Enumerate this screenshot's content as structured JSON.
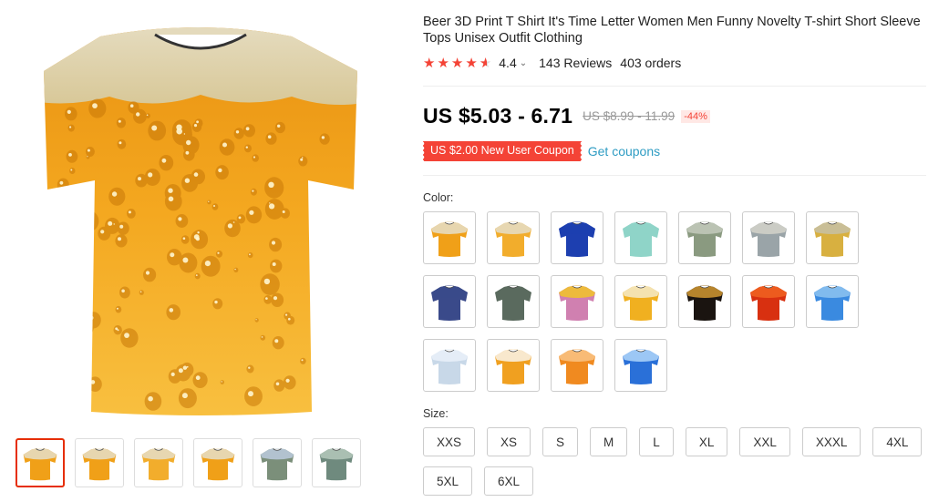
{
  "product": {
    "title": "Beer 3D Print T Shirt It's Time Letter Women Men Funny Novelty T-shirt Short Sleeve Tops Unisex Outfit Clothing",
    "rating_value": "4.4",
    "rating_stars": 4.4,
    "reviews": "143 Reviews",
    "orders": "403 orders",
    "price": "US $5.03 - 6.71",
    "original_price": "US $8.99 - 11.99",
    "discount": "-44%",
    "coupon": "US $2.00 New User Coupon",
    "get_coupons": "Get coupons",
    "color_label": "Color:",
    "size_label": "Size:",
    "sizes": [
      "XXS",
      "XS",
      "S",
      "M",
      "L",
      "XL",
      "XXL",
      "XXXL",
      "4XL",
      "5XL",
      "6XL"
    ]
  },
  "colors": {
    "accent": "#f44336",
    "link": "#2e9cc3",
    "selected_border": "#e62e04",
    "beer": "#f0a018",
    "foam": "#e6dcc0"
  },
  "thumbnails": [
    {
      "icon": "beer-shirt-icon",
      "fill": "#f0a018",
      "top": "#e6dcc0"
    },
    {
      "icon": "beer-shirt-icon",
      "fill": "#f0a018",
      "top": "#e6dcc0"
    },
    {
      "icon": "beer-print-shirt-icon",
      "fill": "#f2ad2c",
      "top": "#e6dcc0"
    },
    {
      "icon": "beer-shirt-icon",
      "fill": "#f0a018",
      "top": "#e6dcc0"
    },
    {
      "icon": "cartoon-shirt-icon",
      "fill": "#7b8f7a",
      "top": "#b8c8d8"
    },
    {
      "icon": "cartoon-shirt-icon",
      "fill": "#6f8a7e",
      "top": "#b0c4b8"
    }
  ],
  "color_swatches": [
    {
      "icon": "beer-shirt-icon",
      "fill": "#f0a018",
      "top": "#e6dcc0"
    },
    {
      "icon": "beer-print-shirt-icon",
      "fill": "#f2ad2c",
      "top": "#e6dcc0"
    },
    {
      "icon": "blue-cartoon-shirt-icon",
      "fill": "#1d3fb0",
      "top": "#1d3fb0"
    },
    {
      "icon": "mint-cartoon-shirt-icon",
      "fill": "#8fd4c8",
      "top": "#8fd4c8"
    },
    {
      "icon": "collage-shirt-icon",
      "fill": "#8a9a80",
      "top": "#c0c8b8"
    },
    {
      "icon": "collage-shirt-icon",
      "fill": "#9aa4a8",
      "top": "#d0d0c8"
    },
    {
      "icon": "cartoon-collage-shirt-icon",
      "fill": "#d8b040",
      "top": "#c8c0a0"
    },
    {
      "icon": "navy-cartoon-shirt-icon",
      "fill": "#3a4a8a",
      "top": "#3a4a8a"
    },
    {
      "icon": "gray-cartoon-shirt-icon",
      "fill": "#5a6a5e",
      "top": "#5a6a5e"
    },
    {
      "icon": "pink-cartoon-shirt-icon",
      "fill": "#d080b0",
      "top": "#f0c030"
    },
    {
      "icon": "beer-foam-shirt-icon",
      "fill": "#f0b020",
      "top": "#f4e8c0"
    },
    {
      "icon": "black-gold-shirt-icon",
      "fill": "#1a1410",
      "top": "#c89030"
    },
    {
      "icon": "red-fire-shirt-icon",
      "fill": "#d83010",
      "top": "#f06020"
    },
    {
      "icon": "blue-bubble-shirt-icon",
      "fill": "#3a8ae0",
      "top": "#8ac0f0"
    },
    {
      "icon": "ice-shirt-icon",
      "fill": "#c8d8e8",
      "top": "#e8f0f8"
    },
    {
      "icon": "beer-mug-shirt-icon",
      "fill": "#f0a020",
      "top": "#f8f0e0"
    },
    {
      "icon": "orange-cartoon-shirt-icon",
      "fill": "#f08a20",
      "top": "#f8c080"
    },
    {
      "icon": "blue-water-shirt-icon",
      "fill": "#2a70d8",
      "top": "#a8d0f8"
    }
  ]
}
